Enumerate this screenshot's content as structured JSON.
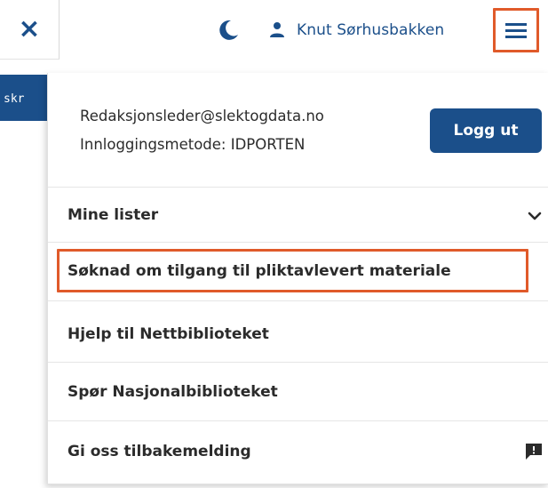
{
  "topbar": {
    "close_label": "×",
    "user_name": "Knut Sørhusbakken",
    "icons": {
      "close": "close-icon",
      "theme": "moon-icon",
      "user": "user-icon",
      "menu": "hamburger-menu-icon"
    }
  },
  "side_strip": {
    "text": "skr"
  },
  "account": {
    "email": "Redaksjonsleder@slektogdata.no",
    "login_method": "Innloggingsmetode: IDPORTEN",
    "logout_label": "Logg ut"
  },
  "menu": {
    "items": [
      {
        "label": "Mine lister",
        "icon": "chevron-down-icon"
      },
      {
        "label": "Søknad om tilgang til pliktavlevert materiale"
      },
      {
        "label": "Hjelp til Nettbiblioteket"
      },
      {
        "label": "Spør Nasjonalbiblioteket"
      },
      {
        "label": "Gi oss tilbakemelding",
        "icon": "feedback-icon"
      }
    ]
  },
  "colors": {
    "primary": "#1b4f8a",
    "highlight": "#e05a2a",
    "text": "#2b2b2b"
  }
}
